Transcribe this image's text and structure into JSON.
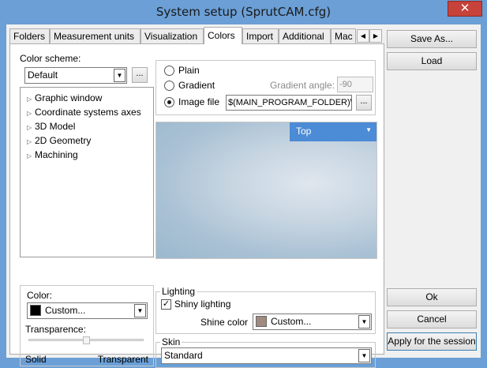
{
  "window": {
    "title": "System setup (SprutCAM.cfg)",
    "close_glyph": "✕"
  },
  "tabs": {
    "items": [
      "Folders",
      "Measurement units",
      "Visualization",
      "Colors",
      "Import",
      "Additional",
      "Mac"
    ],
    "active": "Colors",
    "scroll_left_glyph": "◀",
    "scroll_right_glyph": "▶"
  },
  "colors_page": {
    "scheme_label": "Color scheme:",
    "scheme_value": "Default",
    "ellipsis": "...",
    "tree": [
      "Graphic window",
      "Coordinate systems axes",
      "3D Model",
      "2D Geometry",
      "Machining"
    ],
    "expand_glyph": "▷",
    "background": {
      "plain_label": "Plain",
      "gradient_label": "Gradient",
      "gradient_angle_label": "Gradient angle:",
      "gradient_angle_value": "-90",
      "image_file_label": "Image file",
      "image_file_value": "$(MAIN_PROGRAM_FOLDER)\\",
      "selected": "Image file"
    },
    "preview": {
      "position_value": "Top"
    },
    "color_box": {
      "color_label": "Color:",
      "color_value": "Custom...",
      "color_swatch": "#000000",
      "transparence_label": "Transparence:",
      "solid_label": "Solid",
      "transparent_label": "Transparent",
      "transparence_level": 0.5
    },
    "lighting": {
      "group_label": "Lighting",
      "shiny_label": "Shiny lighting",
      "shiny_checked": true,
      "shine_color_label": "Shine color",
      "shine_color_value": "Custom...",
      "shine_swatch": "#a08a80"
    },
    "skin": {
      "group_label": "Skin",
      "value": "Standard"
    }
  },
  "side_buttons": {
    "save_as": "Save As...",
    "load": "Load",
    "ok": "Ok",
    "cancel": "Cancel",
    "apply": "Apply for the session"
  },
  "accent": "#4c8bd5"
}
